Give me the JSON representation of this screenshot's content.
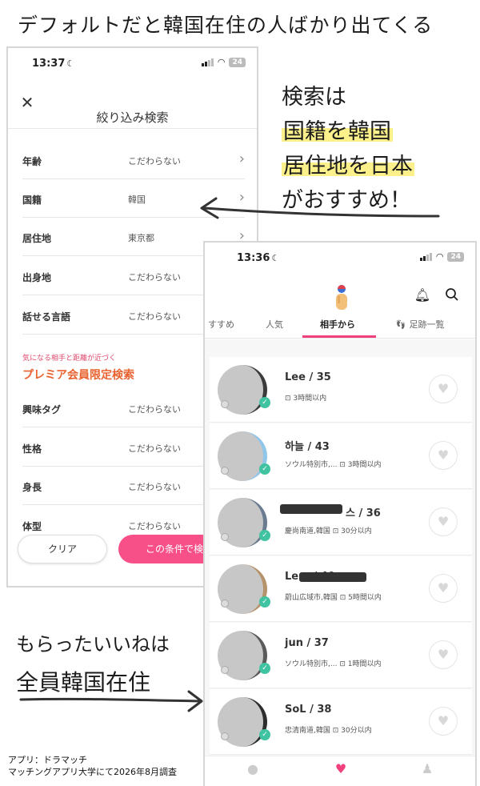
{
  "headline": "デフォルトだと韓国在住の人ばかり出てくる",
  "left_phone": {
    "status": {
      "time": "13:37",
      "battery": "24"
    },
    "title": "絞り込み検索",
    "rows": [
      {
        "label": "年齢",
        "value": "こだわらない"
      },
      {
        "label": "国籍",
        "value": "韓国"
      },
      {
        "label": "居住地",
        "value": "東京都"
      },
      {
        "label": "出身地",
        "value": "こだわらない"
      },
      {
        "label": "話せる言語",
        "value": "こだわらない"
      }
    ],
    "premium_note": "気になる相手と距離が近づく",
    "premium_title": "プレミア会員限定検索",
    "premium_rows": [
      {
        "label": "興味タグ",
        "value": "こだわらない"
      },
      {
        "label": "性格",
        "value": "こだわらない"
      },
      {
        "label": "身長",
        "value": "こだわらない"
      },
      {
        "label": "体型",
        "value": "こだわらない"
      }
    ],
    "clear_label": "クリア",
    "apply_label": "この条件で検"
  },
  "right_phone": {
    "status": {
      "time": "13:36",
      "battery": "24"
    },
    "tabs": [
      "すすめ",
      "人気",
      "相手から",
      "足跡一覧"
    ],
    "active_tab": "相手から",
    "cards": [
      {
        "name": "Lee / 35",
        "location": "",
        "time": "3時間以内"
      },
      {
        "name": "하늘 / 43",
        "location": "ソウル特別市,...",
        "time": "3時間以内"
      },
      {
        "name": "스 / 36",
        "location": "慶尚南道,韓国",
        "time": "30分以内"
      },
      {
        "name": "Le          n / 40",
        "location": "蔚山広域市,韓国",
        "time": "5時間以内"
      },
      {
        "name": "jun / 37",
        "location": "ソウル特別市,...",
        "time": "1時間以内"
      },
      {
        "name": "SoL / 38",
        "location": "忠清南道,韓国",
        "time": "30分以内"
      }
    ]
  },
  "annotations": {
    "recommend": [
      "検索は",
      "国籍を韓国",
      "居住地を日本",
      "がおすすめ！"
    ],
    "likes": [
      "もらったいいねは",
      "全員韓国在住"
    ]
  },
  "credit": [
    "アプリ：ドラマッチ",
    "マッチングアプリ大学にて2026年8月調査"
  ],
  "colors": {
    "accent_pink": "#f74f87",
    "premium_orange": "#e8622f",
    "verified_green": "#3fc3a0",
    "highlight_yellow": "#fbf08a"
  }
}
